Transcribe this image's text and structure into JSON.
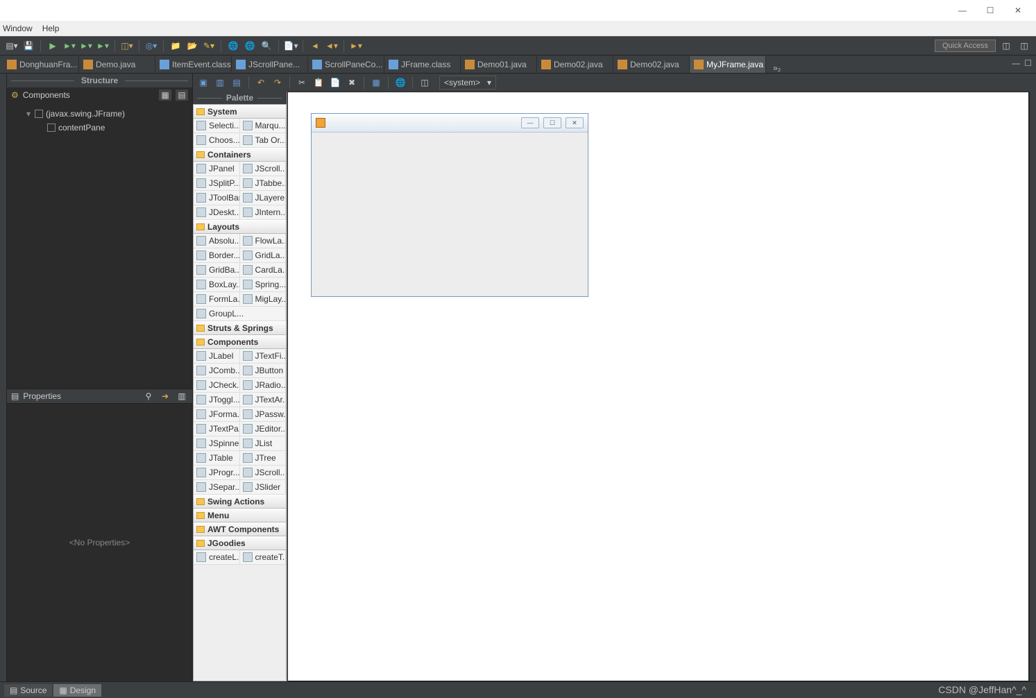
{
  "menubar": {
    "window": "Window",
    "help": "Help"
  },
  "toolbar": {
    "quick_access": "Quick Access"
  },
  "tabs": [
    {
      "label": "DonghuanFra...",
      "kind": "java"
    },
    {
      "label": "Demo.java",
      "kind": "java"
    },
    {
      "label": "ItemEvent.class",
      "kind": "class"
    },
    {
      "label": "JScrollPane...",
      "kind": "class"
    },
    {
      "label": "ScrollPaneCo...",
      "kind": "class"
    },
    {
      "label": "JFrame.class",
      "kind": "class"
    },
    {
      "label": "Demo01.java",
      "kind": "java"
    },
    {
      "label": "Demo02.java",
      "kind": "java"
    },
    {
      "label": "Demo02.java",
      "kind": "java"
    },
    {
      "label": "MyJFrame.java",
      "kind": "java",
      "active": true,
      "closable": true
    }
  ],
  "tabs_overflow": "»₂",
  "structure": {
    "title": "Structure",
    "components_label": "Components",
    "tree": [
      {
        "label": "(javax.swing.JFrame)",
        "depth": 1,
        "hasChildren": true
      },
      {
        "label": "contentPane",
        "depth": 2
      }
    ]
  },
  "properties": {
    "title": "Properties",
    "empty": "<No Properties>"
  },
  "editor_toolbar_system": "<system>",
  "palette": {
    "title": "Palette",
    "groups": [
      {
        "name": "System",
        "items": [
          [
            "Selecti...",
            "Marqu..."
          ],
          [
            "Choos...",
            "Tab Or..."
          ]
        ]
      },
      {
        "name": "Containers",
        "items": [
          [
            "JPanel",
            "JScroll..."
          ],
          [
            "JSplitP...",
            "JTabbe..."
          ],
          [
            "JToolBar",
            "JLayere..."
          ],
          [
            "JDeskt...",
            "JIntern..."
          ]
        ]
      },
      {
        "name": "Layouts",
        "items": [
          [
            "Absolu...",
            "FlowLa..."
          ],
          [
            "Border...",
            "GridLa..."
          ],
          [
            "GridBa...",
            "CardLa..."
          ],
          [
            "BoxLay...",
            "Spring..."
          ],
          [
            "FormLa...",
            "MigLay..."
          ],
          [
            "GroupL..."
          ]
        ]
      },
      {
        "name": "Struts & Springs",
        "items": []
      },
      {
        "name": "Components",
        "items": [
          [
            "JLabel",
            "JTextFi..."
          ],
          [
            "JComb...",
            "JButton"
          ],
          [
            "JCheck...",
            "JRadio..."
          ],
          [
            "JToggl...",
            "JTextAr..."
          ],
          [
            "JForma...",
            "JPassw..."
          ],
          [
            "JTextPa...",
            "JEditor..."
          ],
          [
            "JSpinner",
            "JList"
          ],
          [
            "JTable",
            "JTree"
          ],
          [
            "JProgr...",
            "JScroll..."
          ],
          [
            "JSepar...",
            "JSlider"
          ]
        ]
      },
      {
        "name": "Swing Actions",
        "items": []
      },
      {
        "name": "Menu",
        "items": []
      },
      {
        "name": "AWT Components",
        "items": []
      },
      {
        "name": "JGoodies",
        "items": [
          [
            "createL...",
            "createT..."
          ]
        ]
      }
    ]
  },
  "statusbar": {
    "source": "Source",
    "design": "Design"
  },
  "watermark": "CSDN @JeffHan^_^"
}
